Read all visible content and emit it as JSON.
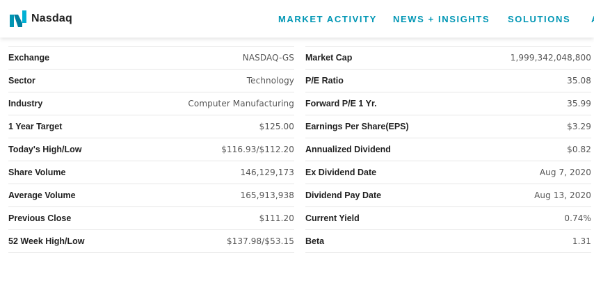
{
  "brand": {
    "name": "Nasdaq",
    "accent_color": "#0096b4",
    "logo_color": "#0096b4"
  },
  "nav": [
    {
      "label": "MARKET ACTIVITY"
    },
    {
      "label": "NEWS + INSIGHTS"
    },
    {
      "label": "SOLUTIONS"
    },
    {
      "label": "A"
    }
  ],
  "summary_left": [
    {
      "label": "Exchange",
      "value": "NASDAQ-GS"
    },
    {
      "label": "Sector",
      "value": "Technology"
    },
    {
      "label": "Industry",
      "value": "Computer Manufacturing"
    },
    {
      "label": "1 Year Target",
      "value": "$125.00"
    },
    {
      "label": "Today's High/Low",
      "value": "$116.93/$112.20"
    },
    {
      "label": "Share Volume",
      "value": "146,129,173"
    },
    {
      "label": "Average Volume",
      "value": "165,913,938"
    },
    {
      "label": "Previous Close",
      "value": "$111.20"
    },
    {
      "label": "52 Week High/Low",
      "value": "$137.98/$53.15"
    }
  ],
  "summary_right": [
    {
      "label": "Market Cap",
      "value": "1,999,342,048,800"
    },
    {
      "label": "P/E Ratio",
      "value": "35.08"
    },
    {
      "label": "Forward P/E 1 Yr.",
      "value": "35.99"
    },
    {
      "label": "Earnings Per Share(EPS)",
      "value": "$3.29"
    },
    {
      "label": "Annualized Dividend",
      "value": "$0.82"
    },
    {
      "label": "Ex Dividend Date",
      "value": "Aug 7, 2020"
    },
    {
      "label": "Dividend Pay Date",
      "value": "Aug 13, 2020"
    },
    {
      "label": "Current Yield",
      "value": "0.74%"
    },
    {
      "label": "Beta",
      "value": "1.31"
    }
  ]
}
